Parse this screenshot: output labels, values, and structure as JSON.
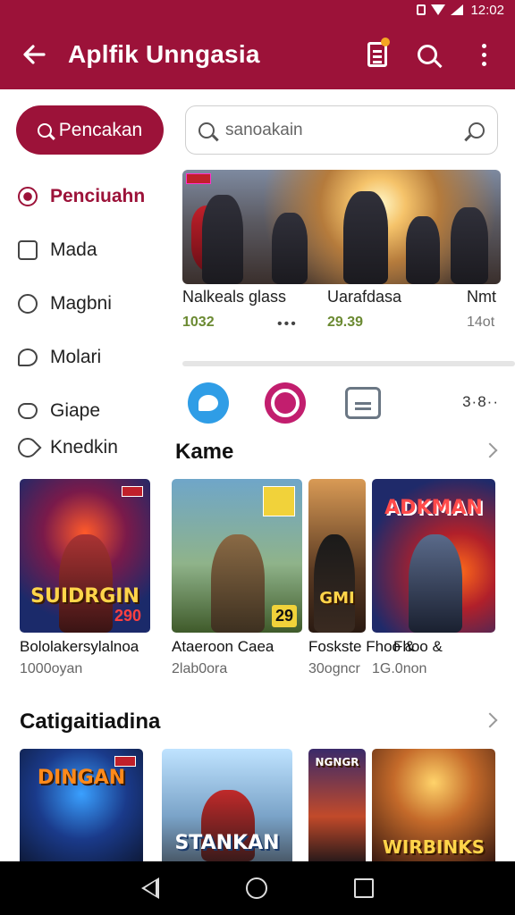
{
  "status_bar": {
    "time": "12:02"
  },
  "app_bar": {
    "title": "Aplfik Unngasia"
  },
  "search": {
    "button_label": "Pencakan",
    "placeholder": "sanoakain"
  },
  "side_menu": [
    {
      "label": "Penciuahn",
      "icon": "target-icon",
      "active": true
    },
    {
      "label": "Mada",
      "icon": "image-icon",
      "active": false
    },
    {
      "label": "Magbni",
      "icon": "clock-icon",
      "active": false
    },
    {
      "label": "Molari",
      "icon": "chat-icon",
      "active": false
    },
    {
      "label": "Giape",
      "icon": "heart-icon",
      "active": false
    }
  ],
  "side_extra": {
    "label": "Knedkin",
    "icon": "link-icon"
  },
  "banner": {
    "items": [
      {
        "title": "Nalkeals glass",
        "sub": "1032"
      },
      {
        "title": "Uarafdasa",
        "sub": "29.39"
      },
      {
        "title": "Nmt",
        "sub": "14ot"
      }
    ],
    "dots": "•••"
  },
  "round_icons": {
    "more": "3·8··"
  },
  "sections": [
    {
      "title": "Kame",
      "cards": [
        {
          "title": "Bololakersylalnoa",
          "sub": "1000oyan",
          "cover_label": "SUIDRGIN",
          "cover_num": "290"
        },
        {
          "title": "Ataeroon Caea",
          "sub": "2lab0ora",
          "cover_label": "",
          "cover_num": "29"
        },
        {
          "title": "Foskste Fhoo &",
          "sub": "30ogncr",
          "cover_label": "GMI",
          "cover_num": ""
        },
        {
          "title": "Fhoo &",
          "sub": "1G.0non",
          "cover_label": "ADKMAN",
          "cover_num": ""
        }
      ]
    },
    {
      "title": "Catigaitiadina",
      "cards": [
        {
          "title": "",
          "sub": "",
          "cover_label": "DINGAN",
          "cover_num": ""
        },
        {
          "title": "",
          "sub": "",
          "cover_label": "STANKAN",
          "cover_num": ""
        },
        {
          "title": "",
          "sub": "",
          "cover_label": "NGNGR",
          "cover_num": ""
        },
        {
          "title": "",
          "sub": "",
          "cover_label": "WIRBINKS",
          "cover_num": ""
        }
      ]
    }
  ],
  "colors": {
    "brand": "#9c1239",
    "accent_green": "#6b8a32"
  }
}
